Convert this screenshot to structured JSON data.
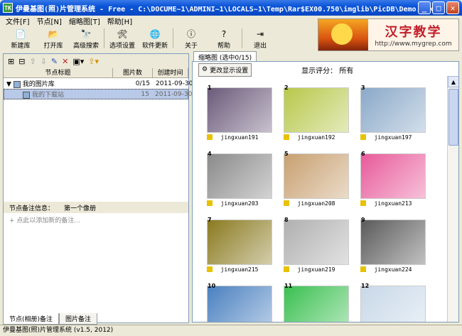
{
  "window": {
    "title": "伊曼基图(照)片管理系统 - Free - C:\\DOCUME~1\\ADMINI~1\\LOCALS~1\\Temp\\Rar$EX00.750\\imglib\\PicDB\\Demo.tpk",
    "app_icon": "TK"
  },
  "menu": [
    "文件[F]",
    "节点[N]",
    "缩略图[T]",
    "帮助[H]"
  ],
  "toolbar": [
    {
      "label": "新建库",
      "icon": "new-file-icon"
    },
    {
      "label": "打开库",
      "icon": "open-folder-icon"
    },
    {
      "label": "高级搜索",
      "icon": "binoculars-icon"
    },
    {
      "label": "选项设置",
      "icon": "tools-icon"
    },
    {
      "label": "软件更新",
      "icon": "globe-icon"
    },
    {
      "label": "关于",
      "icon": "info-icon"
    },
    {
      "label": "帮助",
      "icon": "help-icon"
    },
    {
      "label": "退出",
      "icon": "exit-icon"
    }
  ],
  "logo": {
    "text": "汉字教学",
    "url": "http://www.mygrep.com"
  },
  "tree": {
    "headers": [
      "节点标题",
      "图片数",
      "创建时间"
    ],
    "rows": [
      {
        "title": "我的图片库",
        "count": "0/15",
        "date": "2011-09-30",
        "selected": false
      },
      {
        "title": "我的下载站",
        "count": "15",
        "date": "2011-09-30",
        "selected": true
      }
    ]
  },
  "notes": {
    "label": "节点备注信息：",
    "value": "第一个像册",
    "placeholder": "+ 点此以添加新的备注..."
  },
  "bottom_tabs": [
    "节点(相册)备注",
    "图片备注"
  ],
  "right_tab": "缩略图 (选中0/15)",
  "change_display_label": "更改显示设置",
  "display_rating": "显示评分：  所有",
  "thumbnails": [
    {
      "num": "1",
      "caption": "jingxuan191",
      "color": "#6b5a7a"
    },
    {
      "num": "2",
      "caption": "jingxuan192",
      "color": "#b7c84a"
    },
    {
      "num": "3",
      "caption": "jingxuan197",
      "color": "#8aa8c8"
    },
    {
      "num": "4",
      "caption": "jingxuan203",
      "color": "#8a8a8a"
    },
    {
      "num": "5",
      "caption": "jingxuan208",
      "color": "#c8a070"
    },
    {
      "num": "6",
      "caption": "jingxuan213",
      "color": "#e85a9a"
    },
    {
      "num": "7",
      "caption": "jingxuan215",
      "color": "#8a7a20"
    },
    {
      "num": "8",
      "caption": "jingxuan219",
      "color": "#b0b0b0"
    },
    {
      "num": "9",
      "caption": "jingxuan224",
      "color": "#5a5a5a"
    },
    {
      "num": "10",
      "caption": "",
      "color": "#4a80c0"
    },
    {
      "num": "11",
      "caption": "",
      "color": "#3ac050"
    },
    {
      "num": "12",
      "caption": "",
      "color": "#c8d8e8"
    }
  ],
  "status": "伊曼基图(照)片管理系统  (v1.5, 2012)"
}
